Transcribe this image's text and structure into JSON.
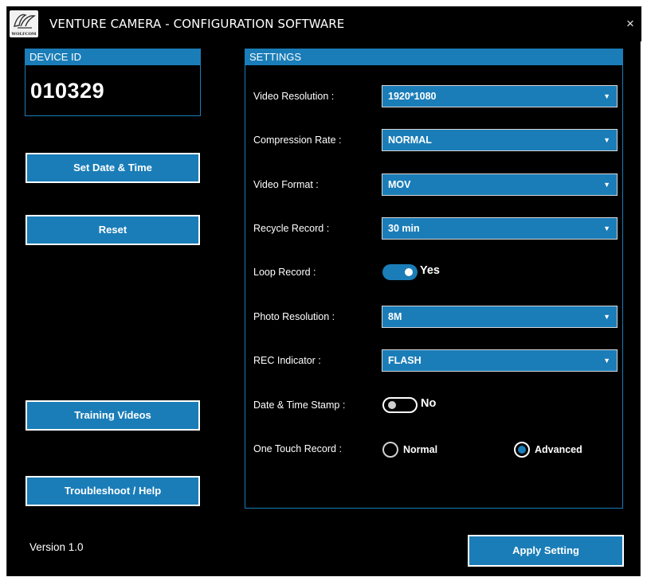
{
  "window": {
    "title": "VENTURE CAMERA - CONFIGURATION SOFTWARE",
    "logo_text": "WOLFCOM",
    "close_glyph": "×"
  },
  "device": {
    "header": "DEVICE ID",
    "value": "010329"
  },
  "side_buttons": {
    "set_date_time": "Set Date & Time",
    "reset": "Reset",
    "training_videos": "Training Videos",
    "troubleshoot": "Troubleshoot / Help"
  },
  "settings": {
    "header": "SETTINGS",
    "video_resolution": {
      "label": "Video Resolution :",
      "value": "1920*1080"
    },
    "compression_rate": {
      "label": "Compression Rate :",
      "value": "NORMAL"
    },
    "video_format": {
      "label": "Video Format :",
      "value": "MOV"
    },
    "recycle_record": {
      "label": "Recycle Record :",
      "value": "30 min"
    },
    "loop_record": {
      "label": "Loop Record :",
      "state": true,
      "state_label": "Yes"
    },
    "photo_resolution": {
      "label": "Photo Resolution :",
      "value": "8M"
    },
    "rec_indicator": {
      "label": "REC Indicator :",
      "value": "FLASH"
    },
    "date_time_stamp": {
      "label": "Date & Time Stamp :",
      "state": false,
      "state_label": "No"
    },
    "one_touch_record": {
      "label": "One Touch Record :",
      "options": [
        "Normal",
        "Advanced"
      ],
      "selected": "Advanced"
    }
  },
  "footer": {
    "version": "Version 1.0",
    "apply_label": "Apply Setting"
  },
  "colors": {
    "accent": "#1a7db8",
    "background": "#000000",
    "text": "#ffffff"
  },
  "icons": {
    "dropdown": "chevron-down-icon",
    "close": "close-icon",
    "logo": "wolfcom-logo-icon"
  }
}
